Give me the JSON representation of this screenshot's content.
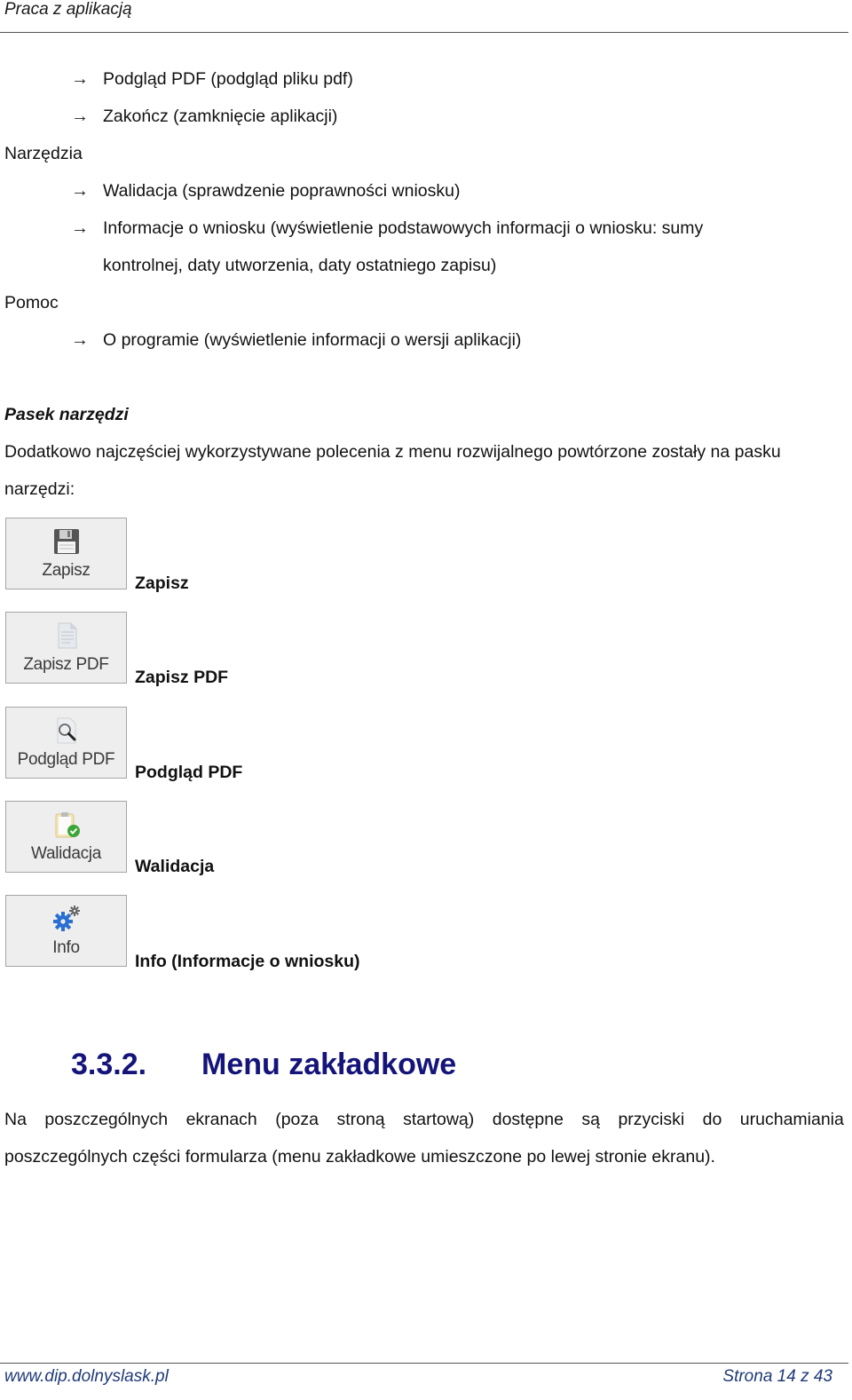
{
  "header": {
    "title": "Praca z aplikacją"
  },
  "menu_list": {
    "file_items": [
      "Podgląd PDF (podgląd pliku pdf)",
      "Zakończ (zamknięcie aplikacji)"
    ],
    "tools_label": "Narzędzia",
    "tools_items": [
      "Walidacja (sprawdzenie poprawności wniosku)",
      "Informacje o wniosku (wyświetlenie podstawowych informacji o wniosku: sumy",
      "kontrolnej, daty utworzenia, daty ostatniego zapisu)"
    ],
    "help_label": "Pomoc",
    "help_items": [
      "O programie (wyświetlenie informacji o wersji aplikacji)"
    ],
    "arrow_icon": "→"
  },
  "toolbar_section": {
    "heading": "Pasek narzędzi",
    "intro_line1": "Dodatkowo najczęściej wykorzystywane polecenia z menu rozwijalnego powtórzone zostały na pasku",
    "intro_line2": "narzędzi:",
    "buttons": [
      {
        "label": "Zapisz",
        "caption": "Zapisz",
        "icon": "floppy-disk-icon"
      },
      {
        "label": "Zapisz PDF",
        "caption": "Zapisz PDF",
        "icon": "document-icon"
      },
      {
        "label": "Podgląd PDF",
        "caption": "Podgląd PDF",
        "icon": "magnifier-document-icon"
      },
      {
        "label": "Walidacja",
        "caption": "Walidacja",
        "icon": "clipboard-check-icon"
      },
      {
        "label": "Info",
        "caption": "Info (Informacje o wniosku)",
        "icon": "gears-icon"
      }
    ]
  },
  "section": {
    "number": "3.3.2.",
    "title": "Menu zakładkowe",
    "para_line1_words": [
      "Na",
      "poszczególnych",
      "ekranach",
      "(poza",
      "stroną",
      "startową)",
      "dostępne",
      "są",
      "przyciski",
      "do",
      "uruchamiania"
    ],
    "para_line2": "poszczególnych części formularza (menu zakładkowe umieszczone po lewej stronie ekranu)."
  },
  "footer": {
    "website": "www.dip.dolnyslask.pl",
    "page_label": "Strona 14 z 43"
  }
}
